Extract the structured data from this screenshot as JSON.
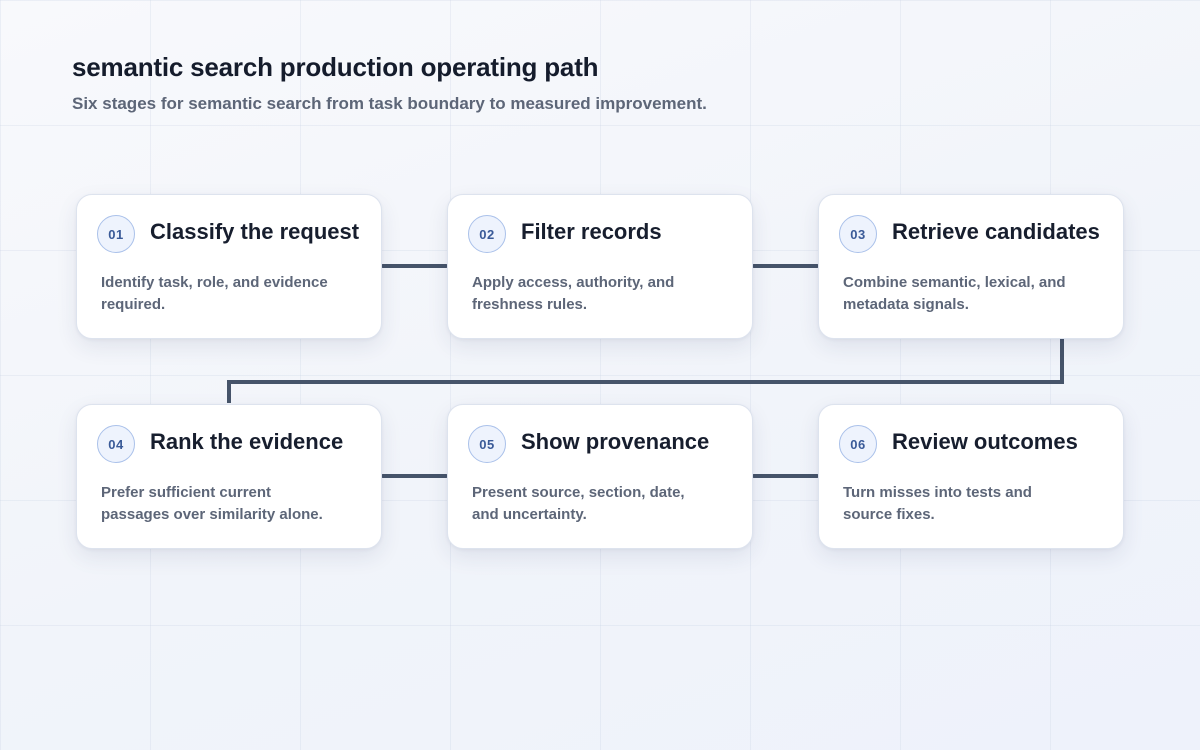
{
  "header": {
    "title": "semantic search production operating path",
    "subtitle": "Six stages for semantic search from task boundary to measured improvement."
  },
  "stages": [
    {
      "number": "01",
      "title": "Classify the request",
      "description": "Identify task, role, and evidence required."
    },
    {
      "number": "02",
      "title": "Filter records",
      "description": "Apply access, authority, and freshness rules."
    },
    {
      "number": "03",
      "title": "Retrieve candidates",
      "description": "Combine semantic, lexical, and metadata signals."
    },
    {
      "number": "04",
      "title": "Rank the evidence",
      "description": "Prefer sufficient current passages over similarity alone."
    },
    {
      "number": "05",
      "title": "Show provenance",
      "description": "Present source, section, date, and uncertainty."
    },
    {
      "number": "06",
      "title": "Review outcomes",
      "description": "Turn misses into tests and source fixes."
    }
  ],
  "colors": {
    "connector": "#46546a",
    "badge_border": "#aac1ea",
    "badge_fill": "#eef3fd",
    "badge_text": "#3a5a98"
  }
}
